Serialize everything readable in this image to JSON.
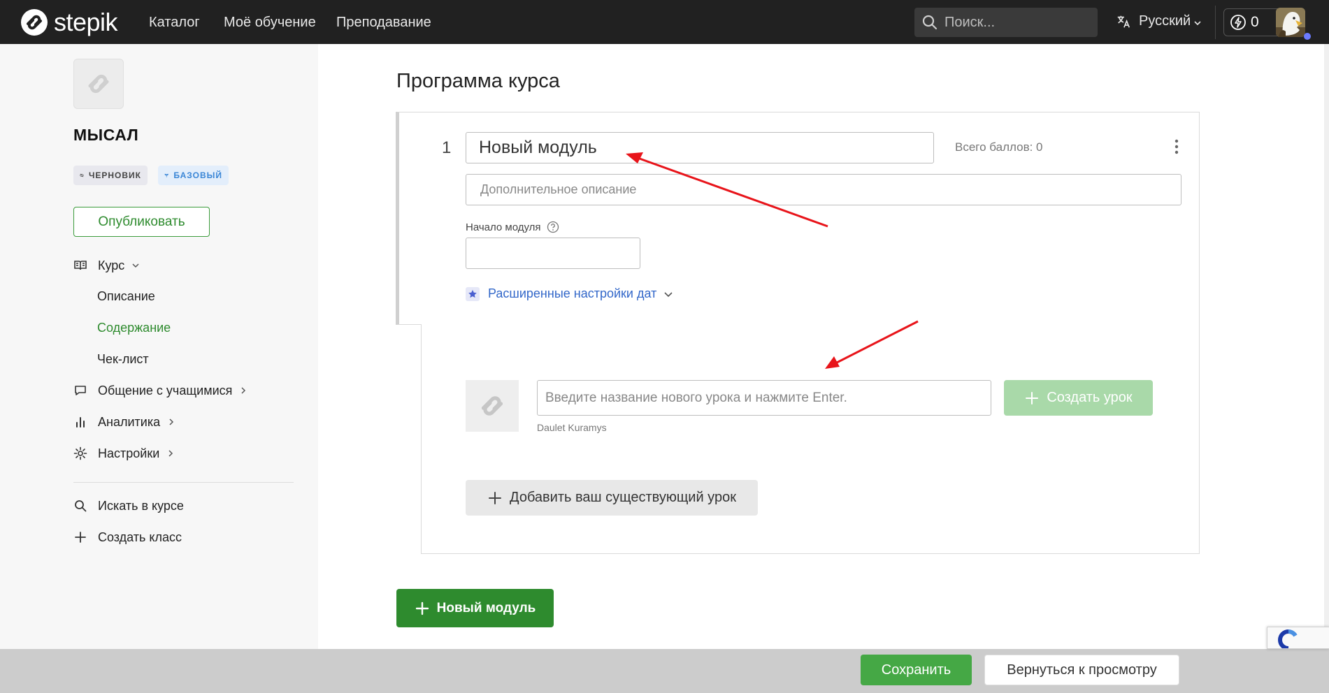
{
  "header": {
    "logo_text": "stepik",
    "nav": [
      "Каталог",
      "Моё обучение",
      "Преподавание"
    ],
    "search_placeholder": "Поиск...",
    "language": "Русский",
    "energy_count": "0"
  },
  "sidebar": {
    "course_title": "МЫСАЛ",
    "badge_draft": "ЧЕРНОВИК",
    "badge_basic": "БАЗОВЫЙ",
    "publish_label": "Опубликовать",
    "course_menu": "Курс",
    "sub_items": [
      "Описание",
      "Содержание",
      "Чек-лист"
    ],
    "communication": "Общение с учащимися",
    "analytics": "Аналитика",
    "settings": "Настройки",
    "search_course": "Искать в курсе",
    "create_class": "Создать класс"
  },
  "main": {
    "page_title": "Программа курса",
    "module": {
      "number": "1",
      "name": "Новый модуль",
      "total_points": "Всего баллов: 0",
      "description_placeholder": "Дополнительное описание",
      "start_label": "Начало модуля",
      "advanced_dates": "Расширенные настройки дат"
    },
    "lesson": {
      "input_placeholder": "Введите название нового урока и нажмите Enter.",
      "author": "Daulet Kuramys",
      "create_label": "Создать урок",
      "add_existing_label": "Добавить ваш существующий урок"
    },
    "new_module_label": "Новый модуль"
  },
  "footer": {
    "save_label": "Сохранить",
    "back_label": "Вернуться к просмотру"
  },
  "colors": {
    "topbar": "#212121",
    "accent_green": "#2e8b2e",
    "link_blue": "#3267c9",
    "annotation_red": "#e8141a"
  }
}
